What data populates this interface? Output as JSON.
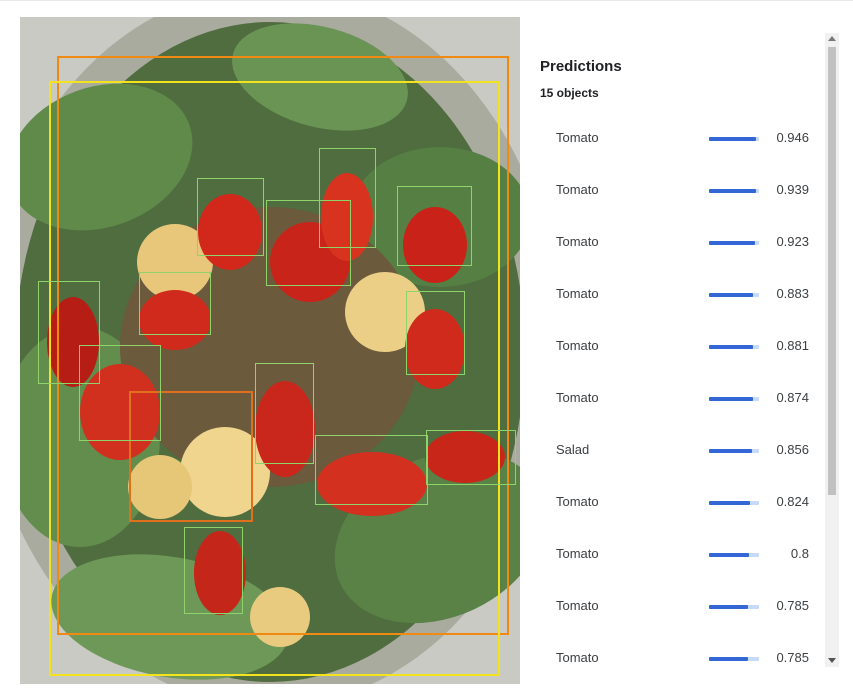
{
  "predictions_panel": {
    "title": "Predictions",
    "count": "15 objects",
    "items": [
      {
        "label": "Tomato",
        "score": "0.946",
        "value": 0.946
      },
      {
        "label": "Tomato",
        "score": "0.939",
        "value": 0.939
      },
      {
        "label": "Tomato",
        "score": "0.923",
        "value": 0.923
      },
      {
        "label": "Tomato",
        "score": "0.883",
        "value": 0.883
      },
      {
        "label": "Tomato",
        "score": "0.881",
        "value": 0.881
      },
      {
        "label": "Tomato",
        "score": "0.874",
        "value": 0.874
      },
      {
        "label": "Salad",
        "score": "0.856",
        "value": 0.856
      },
      {
        "label": "Tomato",
        "score": "0.824",
        "value": 0.824
      },
      {
        "label": "Tomato",
        "score": "0.8",
        "value": 0.8
      },
      {
        "label": "Tomato",
        "score": "0.785",
        "value": 0.785
      },
      {
        "label": "Tomato",
        "score": "0.785",
        "value": 0.785
      }
    ]
  },
  "colors": {
    "bar_fill": "#3367d6",
    "bar_track": "#c6dafc",
    "box_tomato": "#8fd46a",
    "box_salad": "#f08a12",
    "box_food": "#f3e31e",
    "box_baked": "#e0701e"
  }
}
